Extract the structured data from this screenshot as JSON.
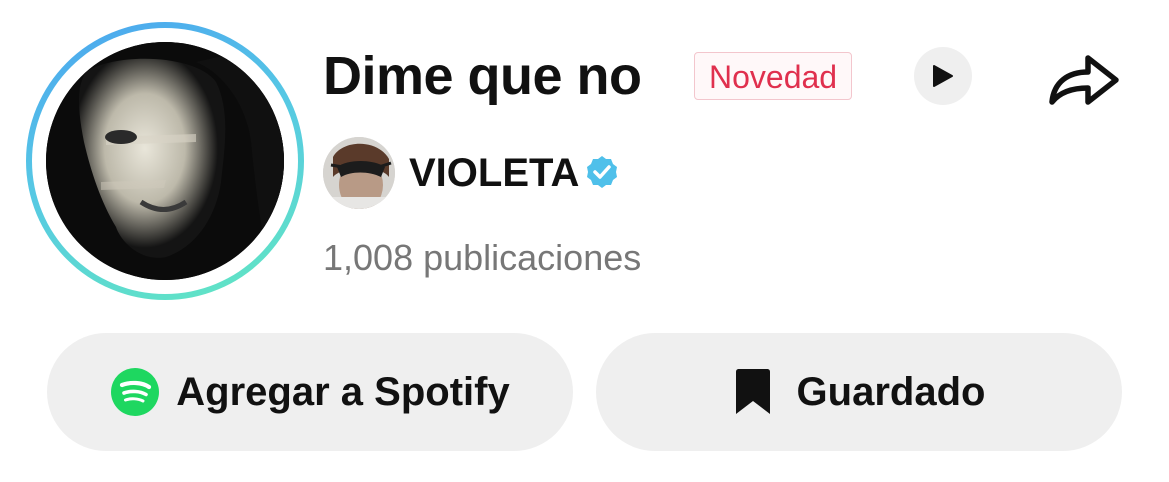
{
  "song": {
    "title": "Dime que no",
    "badge": "Novedad"
  },
  "artist": {
    "name": "VIOLETA",
    "verified": true
  },
  "stats": {
    "posts_label": "1,008 publicaciones"
  },
  "actions": {
    "spotify_label": "Agregar a Spotify",
    "saved_label": "Guardado"
  },
  "icons": {
    "play": "play-icon",
    "share": "share-arrow-icon",
    "verified": "verified-check-icon",
    "spotify": "spotify-logo-icon",
    "bookmark": "bookmark-filled-icon"
  },
  "colors": {
    "badge_text": "#e0304e",
    "badge_border": "#f3c6cd",
    "verified": "#4fc0ea",
    "spotify": "#1ed760",
    "ring_start": "#4aa3f0",
    "ring_end": "#62e8c0",
    "button_bg": "#efefef",
    "muted_text": "#777777"
  }
}
